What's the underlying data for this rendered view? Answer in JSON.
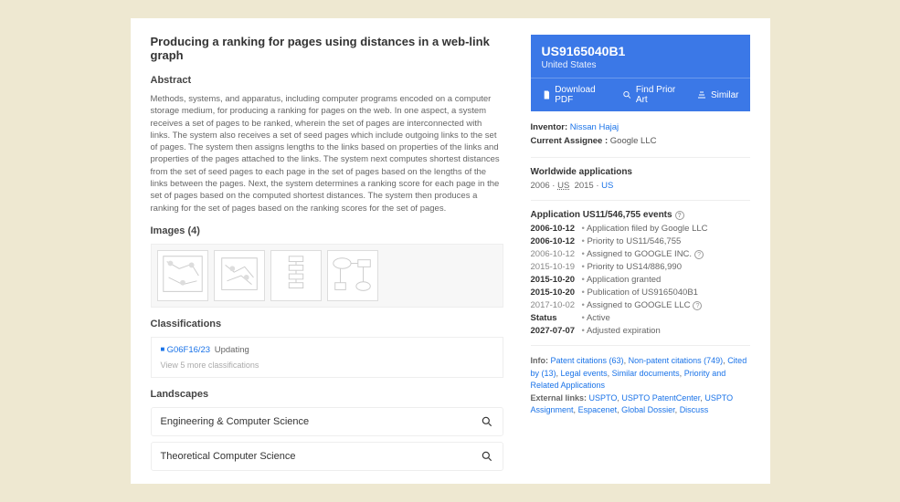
{
  "title": "Producing a ranking for pages using distances in a web-link graph",
  "abstract": {
    "heading": "Abstract",
    "text": "Methods, systems, and apparatus, including computer programs encoded on a computer storage medium, for producing a ranking for pages on the web. In one aspect, a system receives a set of pages to be ranked, wherein the set of pages are interconnected with links. The system also receives a set of seed pages which include outgoing links to the set of pages. The system then assigns lengths to the links based on properties of the links and properties of the pages attached to the links. The system next computes shortest distances from the set of seed pages to each page in the set of pages based on the lengths of the links between the pages. Next, the system determines a ranking score for each page in the set of pages based on the computed shortest distances. The system then produces a ranking for the set of pages based on the ranking scores for the set of pages."
  },
  "images": {
    "heading": "Images (4)"
  },
  "classifications": {
    "heading": "Classifications",
    "code": "G06F16/23",
    "desc": "Updating",
    "more": "View 5 more classifications"
  },
  "landscapes": {
    "heading": "Landscapes",
    "items": [
      "Engineering & Computer Science",
      "Theoretical Computer Science"
    ]
  },
  "patent": {
    "id": "US9165040B1",
    "country": "United States",
    "download": "Download PDF",
    "prior_art": "Find Prior Art",
    "similar": "Similar"
  },
  "meta": {
    "inventor_label": "Inventor:",
    "inventor": "Nissan Hajaj",
    "assignee_label": "Current Assignee :",
    "assignee": "Google LLC"
  },
  "worldwide": {
    "heading": "Worldwide applications",
    "y1": "2006",
    "c1": "US",
    "y2": "2015",
    "c2": "US"
  },
  "events": {
    "heading": "Application US11/546,755 events",
    "rows": [
      {
        "date": "2006-10-12",
        "desc": "Application filed by Google LLC",
        "bold": true
      },
      {
        "date": "2006-10-12",
        "desc": "Priority to US11/546,755",
        "bold": true
      },
      {
        "date": "2006-10-12",
        "desc": "Assigned to GOOGLE INC.",
        "bold": false,
        "info": true
      },
      {
        "date": "2015-10-19",
        "desc": "Priority to US14/886,990",
        "bold": false
      },
      {
        "date": "2015-10-20",
        "desc": "Application granted",
        "bold": true
      },
      {
        "date": "2015-10-20",
        "desc": "Publication of US9165040B1",
        "bold": true
      },
      {
        "date": "2017-10-02",
        "desc": "Assigned to GOOGLE LLC",
        "bold": false,
        "info": true
      },
      {
        "date": "Status",
        "desc": "Active",
        "bold": true
      },
      {
        "date": "2027-07-07",
        "desc": "Adjusted expiration",
        "bold": true
      }
    ]
  },
  "footer": {
    "info_label": "Info:",
    "info_links": [
      "Patent citations (63)",
      "Non-patent citations (749)",
      "Cited by (13)",
      "Legal events",
      "Similar documents",
      "Priority and Related Applications"
    ],
    "ext_label": "External links:",
    "ext_links": [
      "USPTO",
      "USPTO PatentCenter",
      "USPTO Assignment",
      "Espacenet",
      "Global Dossier",
      "Discuss"
    ]
  }
}
